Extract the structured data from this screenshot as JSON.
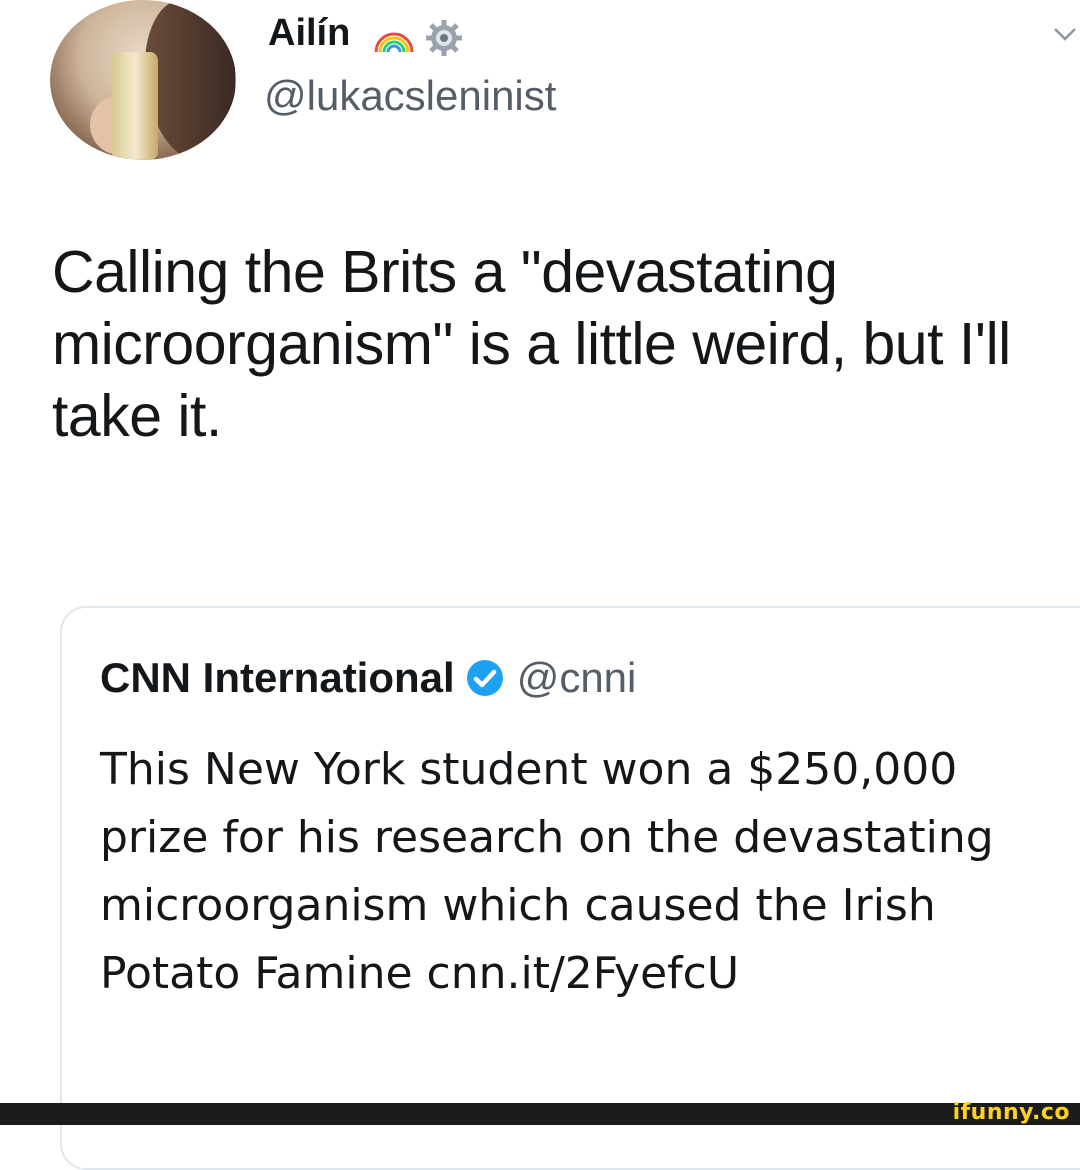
{
  "tweet": {
    "author": {
      "display_name": "Ailín",
      "handle": "@lukacsleninist",
      "emoji_icons": [
        "rainbow-icon",
        "gear-icon"
      ]
    },
    "text": "Calling the Brits a \"devastating microorganism\" is a little weird, but I'll take it.",
    "menu_icon": "chevron-down-icon"
  },
  "quoted_tweet": {
    "author_name": "CNN International",
    "verified_icon": "verified-icon",
    "handle": "@cnni",
    "text": "This New York student won a $250,000 prize for his research on the devastating microorganism which caused the Irish Potato Famine cnn.it/2FyefcU"
  },
  "watermark": "ifunny.co",
  "colors": {
    "text_primary": "#14171a",
    "text_secondary": "#555d66",
    "verified_blue": "#1da1f2",
    "card_border": "#e1e8ed",
    "watermark_yellow": "#ffd21f"
  }
}
